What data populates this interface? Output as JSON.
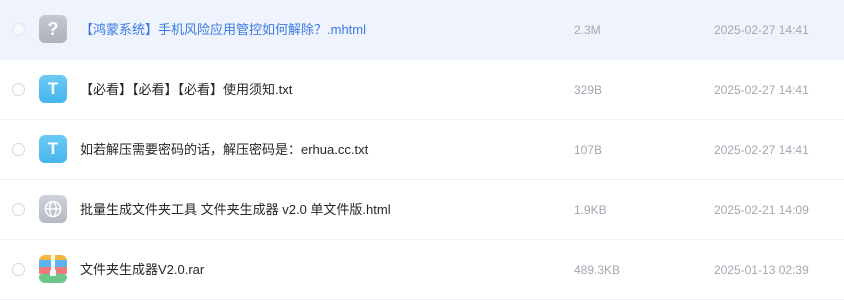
{
  "files": [
    {
      "name": "【鸿蒙系统】手机风险应用管控如何解除？.mhtml",
      "size": "2.3M",
      "date": "2025-02-27 14:41",
      "icon": "unknown-file-icon",
      "icon_glyph": "?"
    },
    {
      "name": "【必看】【必看】【必看】使用须知.txt",
      "size": "329B",
      "date": "2025-02-27 14:41",
      "icon": "txt-file-icon",
      "icon_glyph": "T"
    },
    {
      "name": "如若解压需要密码的话，解压密码是：erhua.cc.txt",
      "size": "107B",
      "date": "2025-02-27 14:41",
      "icon": "txt-file-icon",
      "icon_glyph": "T"
    },
    {
      "name": "批量生成文件夹工具 文件夹生成器 v2.0 单文件版.html",
      "size": "1.9KB",
      "date": "2025-02-21 14:09",
      "icon": "html-globe-icon"
    },
    {
      "name": "文件夹生成器V2.0.rar",
      "size": "489.3KB",
      "date": "2025-01-13 02:39",
      "icon": "rar-archive-icon"
    }
  ],
  "colors": {
    "hover_row_bg": "#eef3fd",
    "hover_name": "#3a7be0",
    "meta_text": "#a3a7b0",
    "txt_icon": "#4ab8ee"
  }
}
